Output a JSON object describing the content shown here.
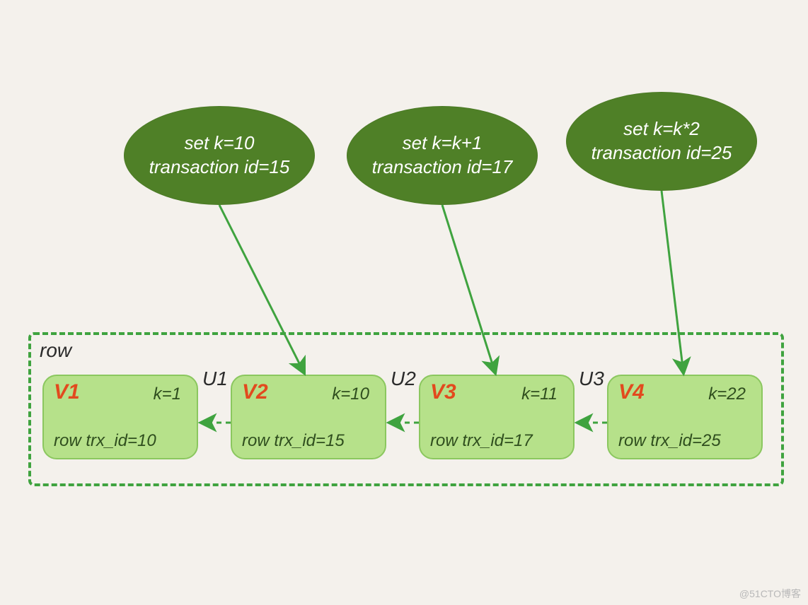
{
  "transactions": [
    {
      "set": "set k=10",
      "txid": "transaction id=15"
    },
    {
      "set": "set k=k+1",
      "txid": "transaction id=17"
    },
    {
      "set": "set k=k*2",
      "txid": "transaction id=25"
    }
  ],
  "row_label": "row",
  "versions": [
    {
      "name": "V1",
      "k": "k=1",
      "trx": "row trx_id=10"
    },
    {
      "name": "V2",
      "k": "k=10",
      "trx": "row trx_id=15"
    },
    {
      "name": "V3",
      "k": "k=11",
      "trx": "row trx_id=17"
    },
    {
      "name": "V4",
      "k": "k=22",
      "trx": "row trx_id=25"
    }
  ],
  "undo_labels": [
    "U1",
    "U2",
    "U3"
  ],
  "watermark": "@51CTO博客"
}
